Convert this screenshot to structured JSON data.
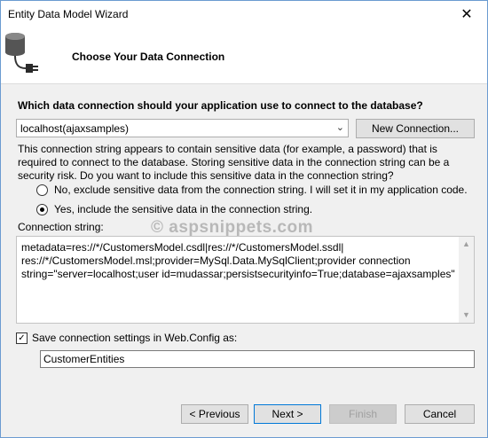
{
  "window": {
    "title": "Entity Data Model Wizard",
    "close_glyph": "✕"
  },
  "header": {
    "title": "Choose Your Data Connection",
    "icon": "database-plug-icon"
  },
  "question": "Which data connection should your application use to connect to the database?",
  "connection": {
    "selected": "localhost(ajaxsamples)",
    "new_button": "New Connection..."
  },
  "warning": "This connection string appears to contain sensitive data (for example, a password) that is required to connect to the database. Storing sensitive data in the connection string can be a security risk. Do you want to include this sensitive data in the connection string?",
  "options": {
    "no_label": "No, exclude sensitive data from the connection string. I will set it in my application code.",
    "yes_label": "Yes, include the sensitive data in the connection string.",
    "selected": "yes"
  },
  "watermark": "© aspsnippets.com",
  "connection_string": {
    "label": "Connection string:",
    "line1": "metadata=res://*/CustomersModel.csdl|res://*/CustomersModel.ssdl|",
    "line2": "res://*/CustomersModel.msl;provider=MySql.Data.MySqlClient;provider connection",
    "line3": "string=\"server=localhost;user id=mudassar;persistsecurityinfo=True;database=ajaxsamples\""
  },
  "save_settings": {
    "label": "Save connection settings in Web.Config as:",
    "checked": true,
    "value": "CustomerEntities"
  },
  "buttons": {
    "previous": "< Previous",
    "next": "Next >",
    "finish": "Finish",
    "cancel": "Cancel"
  },
  "colors": {
    "accent": "#0078d7",
    "window_border": "#6b9bd1"
  }
}
